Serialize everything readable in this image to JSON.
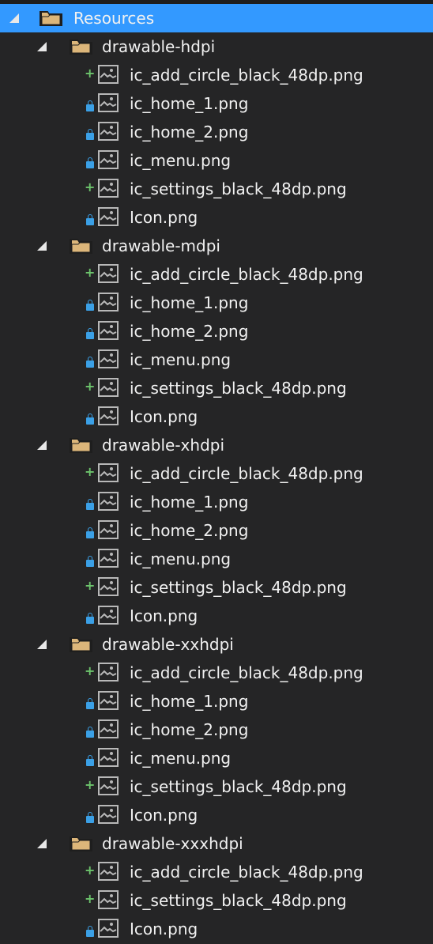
{
  "root": {
    "label": "Resources",
    "icon": "folder-icon",
    "expanded": true,
    "selected": true
  },
  "folders": [
    {
      "label": "drawable-hdpi",
      "files": [
        {
          "name": "ic_add_circle_black_48dp.png",
          "status": "added"
        },
        {
          "name": "ic_home_1.png",
          "status": "locked"
        },
        {
          "name": "ic_home_2.png",
          "status": "locked"
        },
        {
          "name": "ic_menu.png",
          "status": "locked"
        },
        {
          "name": "ic_settings_black_48dp.png",
          "status": "added"
        },
        {
          "name": "Icon.png",
          "status": "locked"
        }
      ]
    },
    {
      "label": "drawable-mdpi",
      "files": [
        {
          "name": "ic_add_circle_black_48dp.png",
          "status": "added"
        },
        {
          "name": "ic_home_1.png",
          "status": "locked"
        },
        {
          "name": "ic_home_2.png",
          "status": "locked"
        },
        {
          "name": "ic_menu.png",
          "status": "locked"
        },
        {
          "name": "ic_settings_black_48dp.png",
          "status": "added"
        },
        {
          "name": "Icon.png",
          "status": "locked"
        }
      ]
    },
    {
      "label": "drawable-xhdpi",
      "files": [
        {
          "name": "ic_add_circle_black_48dp.png",
          "status": "added"
        },
        {
          "name": "ic_home_1.png",
          "status": "locked"
        },
        {
          "name": "ic_home_2.png",
          "status": "locked"
        },
        {
          "name": "ic_menu.png",
          "status": "locked"
        },
        {
          "name": "ic_settings_black_48dp.png",
          "status": "added"
        },
        {
          "name": "Icon.png",
          "status": "locked"
        }
      ]
    },
    {
      "label": "drawable-xxhdpi",
      "files": [
        {
          "name": "ic_add_circle_black_48dp.png",
          "status": "added"
        },
        {
          "name": "ic_home_1.png",
          "status": "locked"
        },
        {
          "name": "ic_home_2.png",
          "status": "locked"
        },
        {
          "name": "ic_menu.png",
          "status": "locked"
        },
        {
          "name": "ic_settings_black_48dp.png",
          "status": "added"
        },
        {
          "name": "Icon.png",
          "status": "locked"
        }
      ]
    },
    {
      "label": "drawable-xxxhdpi",
      "files": [
        {
          "name": "ic_add_circle_black_48dp.png",
          "status": "added"
        },
        {
          "name": "ic_settings_black_48dp.png",
          "status": "added"
        },
        {
          "name": "Icon.png",
          "status": "locked"
        }
      ]
    }
  ],
  "colors": {
    "background": "#252526",
    "selection": "#3399ff",
    "added": "#6cc46c",
    "locked": "#3ba0e6",
    "folder": "#dcb67a"
  }
}
